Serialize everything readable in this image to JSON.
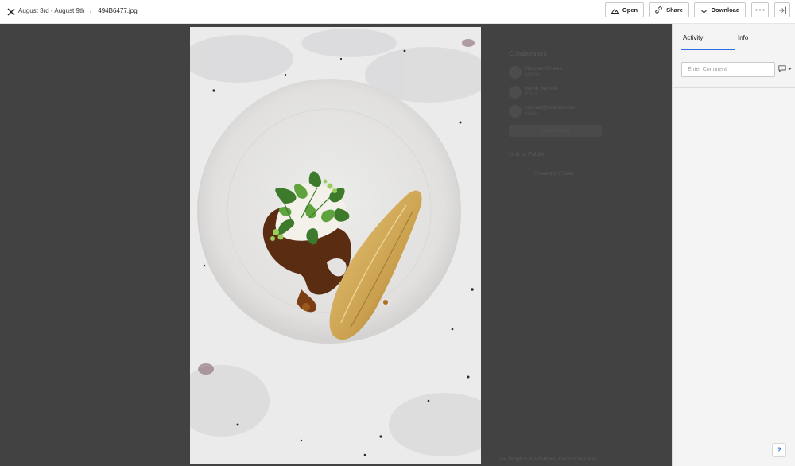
{
  "header": {
    "breadcrumb": {
      "folder": "August 3rd - August 9th",
      "separator": "›",
      "file": "494B6477.jpg"
    },
    "buttons": {
      "open": "Open",
      "share": "Share",
      "download": "Download"
    },
    "icons": {
      "close": "close-icon",
      "open": "open-with-app-icon",
      "share": "link-icon",
      "download": "download-icon",
      "more": "more-icon",
      "panel": "collapse-panel-icon"
    }
  },
  "background_overlay": {
    "title": "Collaborators",
    "people": [
      {
        "name": "Rachael Sharke",
        "role": "Owner"
      },
      {
        "name": "Kevin Swindle",
        "role": "Editor"
      },
      {
        "name": "rachael@crafted.com",
        "role": "Editor"
      }
    ],
    "invite_button": "Invite People",
    "link_label": "Link to Folder",
    "share_button": "Share this Folder",
    "footer": "Use Dropbox in Windows. Get our free app."
  },
  "panel": {
    "tabs": [
      {
        "label": "Activity",
        "active": true
      },
      {
        "label": "Info",
        "active": false
      }
    ],
    "comment": {
      "placeholder": "Enter Comment",
      "value": ""
    },
    "help_label": "?"
  },
  "colors": {
    "accent": "#2c6fe0",
    "viewer_background": "#424242",
    "panel_background": "#f4f4f4"
  }
}
